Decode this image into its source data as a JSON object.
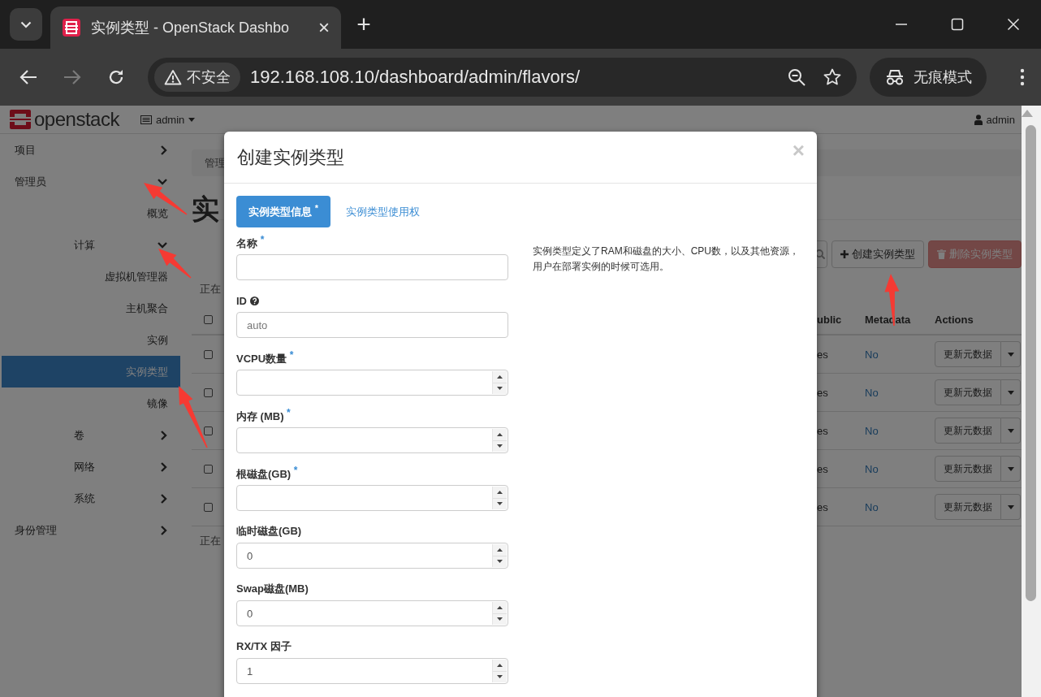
{
  "browser": {
    "tab": {
      "title": "实例类型 - OpenStack Dashbo",
      "close": "×"
    },
    "new_tab": "+",
    "security_label": "不安全",
    "url": "192.168.108.10/dashboard/admin/flavors/",
    "profile_label": "无痕模式"
  },
  "navbar": {
    "logo": "openstack",
    "project": "admin",
    "user": "admin"
  },
  "sidebar": {
    "items": [
      {
        "label": "项目",
        "kind": "group",
        "selected": false,
        "expanded": false
      },
      {
        "label": "管理员",
        "kind": "group",
        "selected": false,
        "expanded": true,
        "children": [
          {
            "label": "概览",
            "kind": "link",
            "selected": false
          },
          {
            "label": "计算",
            "kind": "group",
            "selected": false,
            "expanded": true,
            "children": [
              {
                "label": "虚拟机管理器",
                "kind": "link",
                "selected": false
              },
              {
                "label": "主机聚合",
                "kind": "link",
                "selected": false
              },
              {
                "label": "实例",
                "kind": "link",
                "selected": false
              },
              {
                "label": "实例类型",
                "kind": "link",
                "selected": true
              },
              {
                "label": "镜像",
                "kind": "link",
                "selected": false
              }
            ]
          },
          {
            "label": "卷",
            "kind": "group",
            "selected": false,
            "expanded": false
          },
          {
            "label": "网络",
            "kind": "group",
            "selected": false,
            "expanded": false
          },
          {
            "label": "系统",
            "kind": "group",
            "selected": false,
            "expanded": false
          }
        ]
      },
      {
        "label": "身份管理",
        "kind": "group",
        "selected": false,
        "expanded": false
      }
    ]
  },
  "content": {
    "breadcrumb": "管理",
    "heading": "实",
    "create_button": "创建实例类型",
    "delete_button": {
      "label": "删除实例类型",
      "disabled": true
    },
    "summary_top": "正在",
    "select_all_checked": false,
    "columns": [
      "ublic",
      "Metadata",
      "Actions"
    ],
    "rows": [
      {
        "checked": false,
        "public": "es",
        "metadata": "No",
        "action": "更新元数据"
      },
      {
        "checked": false,
        "public": "es",
        "metadata": "No",
        "action": "更新元数据"
      },
      {
        "checked": false,
        "public": "es",
        "metadata": "No",
        "action": "更新元数据"
      },
      {
        "checked": false,
        "public": "es",
        "metadata": "No",
        "action": "更新元数据"
      },
      {
        "checked": false,
        "public": "es",
        "metadata": "No",
        "action": "更新元数据"
      }
    ],
    "summary_bottom": "正在"
  },
  "modal": {
    "title": "创建实例类型",
    "close": "×",
    "tabs": [
      {
        "label": "实例类型信息 $^{*}$",
        "selected": true
      },
      {
        "label": "实例类型使用权",
        "selected": false
      }
    ],
    "fields": [
      {
        "label": "名称 $^{*}$",
        "kind": "text",
        "help": false
      },
      {
        "label": "ID",
        "kind": "text",
        "help": true,
        "placeholder": "auto"
      },
      {
        "label": "VCPU数量 $^{*}$",
        "kind": "number",
        "help": false
      },
      {
        "label": "内存 (MB) $^{*}$",
        "kind": "number",
        "help": false
      },
      {
        "label": "根磁盘(GB) $^{*}$",
        "kind": "number",
        "help": false
      },
      {
        "label": "临时磁盘(GB)",
        "kind": "number",
        "help": false,
        "value": "0"
      },
      {
        "label": "Swap磁盘(MB)",
        "kind": "number",
        "help": false,
        "value": "0"
      },
      {
        "label": "RX/TX 因子",
        "kind": "number",
        "help": false,
        "value": "1"
      }
    ],
    "description": "实例类型定义了RAM和磁盘的大小、CPU数，以及其他资源，用户在部署实例的时候可选用。"
  }
}
